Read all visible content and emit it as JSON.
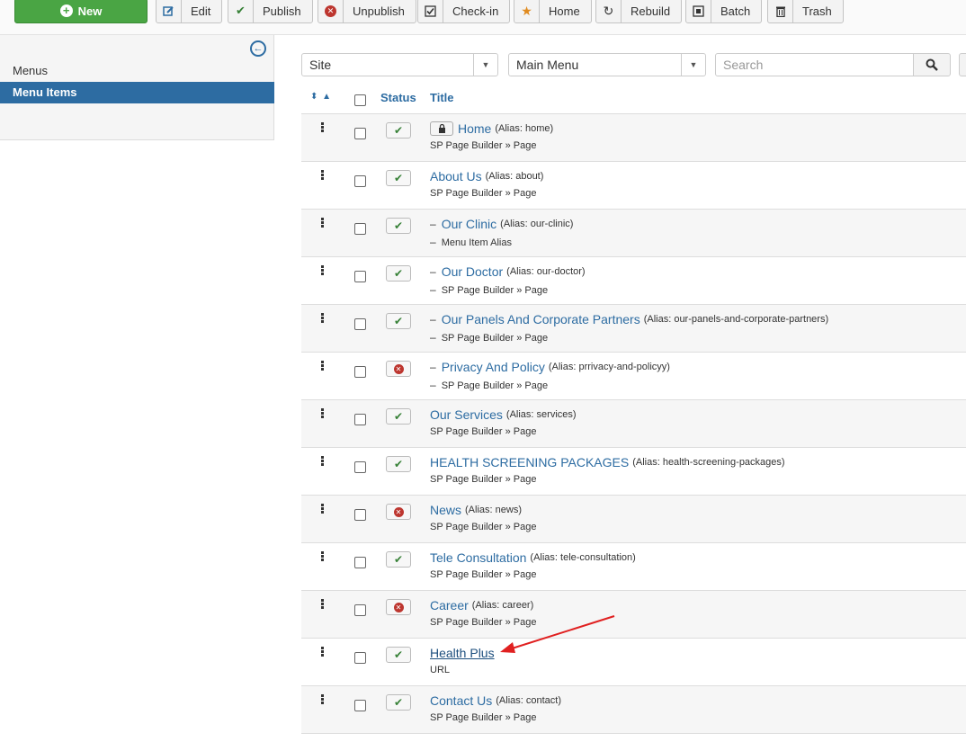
{
  "toolbar": {
    "new_label": "New",
    "edit_label": "Edit",
    "publish_label": "Publish",
    "unpublish_label": "Unpublish",
    "checkin_label": "Check-in",
    "home_label": "Home",
    "rebuild_label": "Rebuild",
    "batch_label": "Batch",
    "trash_label": "Trash"
  },
  "sidebar": {
    "items": [
      {
        "label": "Menus"
      },
      {
        "label": "Menu Items"
      }
    ]
  },
  "filters": {
    "site_value": "Site",
    "menu_value": "Main Menu",
    "search_placeholder": "Search"
  },
  "table": {
    "headers": {
      "status": "Status",
      "title": "Title"
    },
    "rows": [
      {
        "title": "Home",
        "alias": "(Alias: home)",
        "type": "SP Page Builder » Page",
        "status": "published",
        "level": 1,
        "locked": true
      },
      {
        "title": "About Us",
        "alias": "(Alias: about)",
        "type": "SP Page Builder » Page",
        "status": "published",
        "level": 1
      },
      {
        "title": "Our Clinic",
        "alias": "(Alias: our-clinic)",
        "type": "Menu Item Alias",
        "status": "published",
        "level": 2,
        "dash": "–"
      },
      {
        "title": "Our Doctor",
        "alias": "(Alias: our-doctor)",
        "type": "SP Page Builder » Page",
        "status": "published",
        "level": 2,
        "dash": "–"
      },
      {
        "title": "Our Panels And Corporate Partners",
        "alias": "(Alias: our-panels-and-corporate-partners)",
        "type": "SP Page Builder » Page",
        "status": "published",
        "level": 2,
        "dash": "–"
      },
      {
        "title": "Privacy And Policy",
        "alias": "(Alias: prrivacy-and-policyy)",
        "type": "SP Page Builder » Page",
        "status": "unpublished",
        "level": 2,
        "dash": "–"
      },
      {
        "title": "Our Services",
        "alias": "(Alias: services)",
        "type": "SP Page Builder » Page",
        "status": "published",
        "level": 1
      },
      {
        "title": "HEALTH SCREENING PACKAGES",
        "alias": "(Alias: health-screening-packages)",
        "type": "SP Page Builder » Page",
        "status": "published",
        "level": 1
      },
      {
        "title": "News",
        "alias": "(Alias: news)",
        "type": "SP Page Builder » Page",
        "status": "unpublished",
        "level": 1
      },
      {
        "title": "Tele Consultation",
        "alias": "(Alias: tele-consultation)",
        "type": "SP Page Builder » Page",
        "status": "published",
        "level": 1
      },
      {
        "title": "Career",
        "alias": "(Alias: career)",
        "type": "SP Page Builder » Page",
        "status": "unpublished",
        "level": 1
      },
      {
        "title": "Health Plus",
        "alias": "",
        "type": "URL",
        "status": "published",
        "level": 1,
        "hovered": true
      },
      {
        "title": "Contact Us",
        "alias": "(Alias: contact)",
        "type": "SP Page Builder » Page",
        "status": "published",
        "level": 1
      }
    ]
  },
  "icons": {
    "published": "check-icon",
    "unpublished": "times-circle-icon",
    "locked": "lock-icon"
  },
  "colors": {
    "accent": "#2d6ca2",
    "new_button": "#4aa544",
    "published": "#378137",
    "unpublished": "#bd362f",
    "annotation_arrow": "#e02020"
  }
}
